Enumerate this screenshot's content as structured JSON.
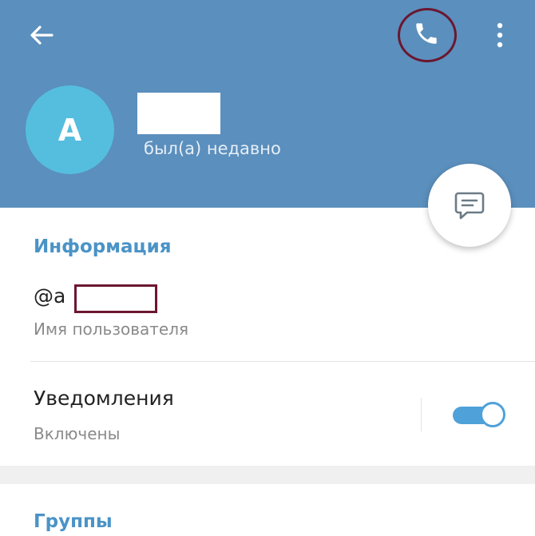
{
  "header": {
    "avatar_letter": "A",
    "last_seen": "был(а) недавно",
    "icons": {
      "back": "back-arrow-icon",
      "call": "phone-icon",
      "menu": "more-vert-icon",
      "message": "message-icon"
    },
    "colors": {
      "header_bg": "#5b8fbd",
      "avatar_bg": "#55bedf",
      "highlight": "#6b1730"
    }
  },
  "info": {
    "section_title": "Информация",
    "username_prefix": "@a",
    "username_label": "Имя пользователя",
    "notifications_label": "Уведомления",
    "notifications_status": "Включены",
    "notifications_enabled": true
  },
  "groups": {
    "section_title": "Группы"
  }
}
